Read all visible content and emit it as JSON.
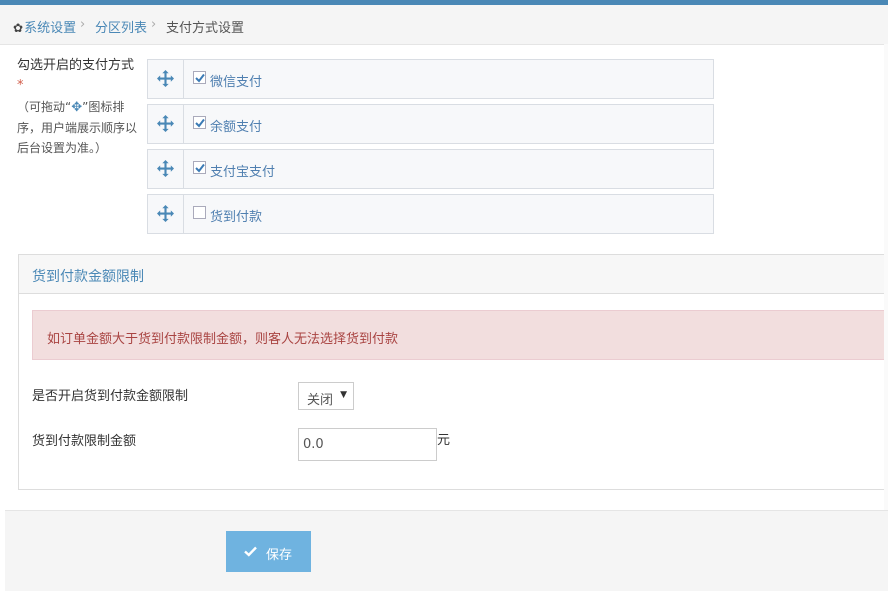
{
  "breadcrumb": {
    "home_icon": "gear-icon",
    "items": [
      "系统设置",
      "分区列表",
      "支付方式设置"
    ]
  },
  "payment": {
    "label": "勾选开启的支付方式",
    "required_mark": "*",
    "hint_before": "（可拖动“",
    "hint_icon": "move-icon",
    "hint_after": "”图标排序，用户端展示顺序以后台设置为准。）",
    "methods": [
      {
        "label": "微信支付",
        "checked": true
      },
      {
        "label": "余额支付",
        "checked": true
      },
      {
        "label": "支付宝支付",
        "checked": true
      },
      {
        "label": "货到付款",
        "checked": false
      }
    ]
  },
  "cod_panel": {
    "title": "货到付款金额限制",
    "alert": "如订单金额大于货到付款限制金额，则客人无法选择货到付款",
    "enable_label": "是否开启货到付款金额限制",
    "enable_value": "关闭",
    "amount_label": "货到付款限制金额",
    "amount_value": "0.0",
    "amount_unit": "元"
  },
  "footer": {
    "save_label": "保存",
    "save_icon": "check-icon"
  },
  "colors": {
    "accent": "#4a88b6",
    "button": "#6fb3e0",
    "alert_bg": "#f2dede",
    "alert_text": "#a94442",
    "required": "#d15b47"
  }
}
